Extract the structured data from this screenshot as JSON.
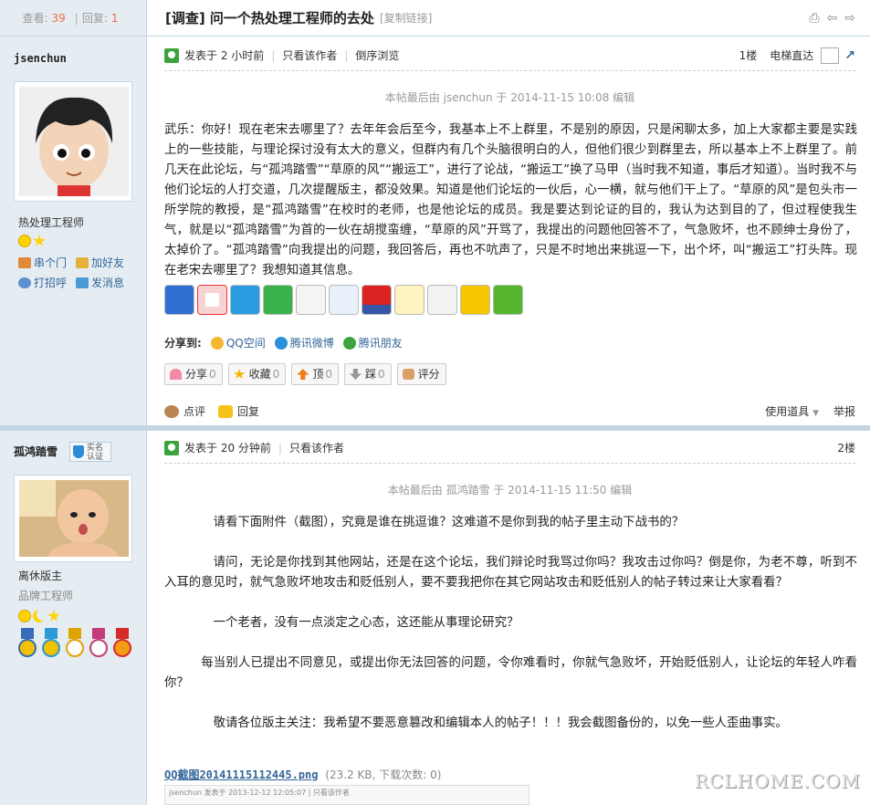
{
  "header": {
    "views_label": "查看:",
    "views": "39",
    "sep": "|",
    "replies_label": "回复:",
    "replies": "1",
    "title": "[调查] 问一个热处理工程师的去处",
    "copy_link": "[复制链接]"
  },
  "post1": {
    "author": {
      "name": "jsenchun",
      "title": "热处理工程师",
      "actions": [
        "串个门",
        "加好友",
        "打招呼",
        "发消息"
      ]
    },
    "meta": {
      "posted": "发表于",
      "time": "2 小时前",
      "only_author": "只看该作者",
      "reverse": "倒序浏览",
      "floor": "1楼",
      "elevator": "电梯直达"
    },
    "edited": "本帖最后由 jsenchun 于 2014-11-15 10:08 编辑",
    "content": "武乐：你好！现在老宋去哪里了？去年年会后至今，我基本上不上群里，不是别的原因，只是闲聊太多，加上大家都主要是实践上的一些技能，与理论探讨没有太大的意义，但群内有几个头脑很明白的人，但他们很少到群里去，所以基本上不上群里了。前几天在此论坛，与“孤鸿踏雪”“草原的风”“搬运工”，进行了论战，“搬运工”换了马甲（当时我不知道，事后才知道）。当时我不与他们论坛的人打交道，几次提醒版主，都没效果。知道是他们论坛的一伙后，心一横，就与他们干上了。“草原的风”是包头市一所学院的教授，是“孤鸿踏雪”在校时的老师，也是他论坛的成员。我是要达到论证的目的，我认为达到目的了，但过程使我生气，就是以“孤鸿踏雪”为首的一伙在胡搅蛮缠，“草原的风”开骂了，我提出的问题他回答不了，气急败坏，也不顾绅士身份了，太掉价了。“孤鸿踏雪”向我提出的问题，我回答后，再也不吭声了，只是不时地出来挑逗一下，出个坏，叫“搬运工”打头阵。现在老宋去哪里了？我想知道其信息。",
    "share_label": "分享到:",
    "share_targets": [
      "QQ空间",
      "腾讯微博",
      "腾讯朋友"
    ],
    "votes": [
      {
        "label": "分享",
        "count": "0"
      },
      {
        "label": "收藏",
        "count": "0"
      },
      {
        "label": "顶",
        "count": "0"
      },
      {
        "label": "踩",
        "count": "0"
      },
      {
        "label": "评分",
        "count": ""
      }
    ],
    "footer": {
      "comment": "点评",
      "reply": "回复",
      "tools": "使用道具",
      "report": "举报"
    }
  },
  "post2": {
    "author": {
      "name": "孤鸿踏雪",
      "badge": "实名认证",
      "title": "离休版主",
      "subtitle": "品牌工程师"
    },
    "meta": {
      "posted": "发表于",
      "time": "20 分钟前",
      "only_author": "只看该作者",
      "floor": "2楼"
    },
    "edited": "本帖最后由 孤鸿踏雪 于 2014-11-15 11:50 编辑",
    "paragraphs": [
      "请看下面附件（截图），究竟是谁在挑逗谁？这难道不是你到我的帖子里主动下战书的？",
      "请问，无论是你找到其他网站，还是在这个论坛，我们辩论时我骂过你吗？我攻击过你吗？倒是你，为老不尊，听到不入耳的意见时，就气急败坏地攻击和贬低别人，要不要我把你在其它网站攻击和贬低别人的帖子转过来让大家看看？",
      "一个老者，没有一点淡定之心态，这还能从事理论研究？",
      "每当别人已提出不同意见，或提出你无法回答的问题，令你难看时，你就气急败坏，开始贬低别人，让论坛的年轻人咋看你？",
      "敬请各位版主关注：我希望不要恶意篡改和编辑本人的帖子！！！我会截图备份的，以免一些人歪曲事实。"
    ],
    "attachment": {
      "name": "QQ截图20141115112445.png",
      "meta": "(23.2 KB, 下载次数: 0)"
    },
    "thumb_text": "jsenchun  发表于 2013-12-12 12:05:07 | 只看该作者"
  },
  "watermark": "RCLHOME.COM"
}
